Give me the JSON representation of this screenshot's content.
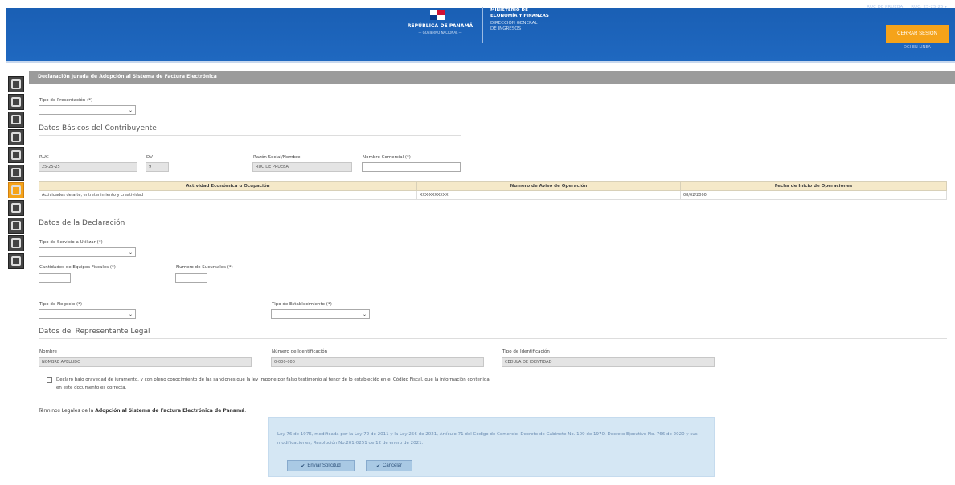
{
  "header": {
    "republic_name": "REPÚBLICA DE PANAMÁ",
    "republic_sub": "— GOBIERNO NACIONAL —",
    "ministry_line1": "MINISTERIO DE",
    "ministry_line2": "ECONOMÍA Y FINANZAS",
    "dgi_line1": "DIRECCIÓN GENERAL",
    "dgi_line2": "DE INGRESOS",
    "user_name": "RUC DE PRUEBA",
    "user_ruc": "RUC: 25-25-25 ▾",
    "logout_label": "CERRAR SESION",
    "dgi_online": "DGI EN LINEA"
  },
  "panel": {
    "title": "Declaración Jurada de Adopción al Sistema de Factura Electrónica"
  },
  "presentacion": {
    "label": "Tipo de Presentación (*)"
  },
  "basicos": {
    "title": "Datos Básicos del Contribuyente",
    "ruc_label": "RUC",
    "ruc_value": "25-25-25",
    "dv_label": "DV",
    "dv_value": "9",
    "razon_label": "Razón Social/Nombre",
    "razon_value": "RUC DE PRUEBA",
    "comercial_label": "Nombre Comercial (*)"
  },
  "activity_table": {
    "headers": [
      "Actividad Económica u Ocupación",
      "Numero de Aviso de Operación",
      "Fecha de Inicio de Operaciones"
    ],
    "row": [
      "Actividades de arte, entretenimiento y creatividad",
      "XXX-XXXXXXX",
      "08/02/2000"
    ]
  },
  "declaracion": {
    "title": "Datos de la Declaración",
    "servicio_label": "Tipo de Servicio a Utilizar (*)",
    "equipos_label": "Cantidades de Equipos Fiscales (*)",
    "sucursales_label": "Numero de Sucursales (*)",
    "negocio_label": "Tipo de Negocio (*)",
    "establecimiento_label": "Tipo de Establecimiento (*)"
  },
  "representante": {
    "title": "Datos del Representante Legal",
    "nombre_label": "Nombre",
    "nombre_value": "NOMBRE APELLIDO",
    "numero_label": "Número de Identificación",
    "numero_value": "0-000-000",
    "tipo_label": "Tipo de Identificación",
    "tipo_value": "CEDULA DE IDENTIDAD"
  },
  "declaro_text": "Declaro bajo gravedad de juramento, y con pleno conocimiento de las sanciones que la ley impone por falso testimonio al tenor de lo establecido en el Código Fiscal, que la información contenida en este documento es correcta.",
  "terminos": {
    "prefix": "Términos Legales de la ",
    "bold": "Adopción al Sistema de Factura Electrónica de Panamá",
    "suffix": "."
  },
  "legal": {
    "text": "Ley 76 de 1976, modificada por la Ley 72 de 2011 y la Ley 256 de 2021, Artículo 71 del Código de Comercio. Decreto de Gabinete No. 109 de 1970. Decreto Ejecutivo No. 766 de 2020 y sus modificaciones, Resolución No.201-0251 de 12 de enero de 2021.",
    "submit_label": "Enviar Solicitud",
    "cancel_label": "Cancelar"
  },
  "icons": [
    "check-icon",
    "chevron-down-icon",
    "panama-flag-icon"
  ],
  "colors": {
    "header_blue": "#1a5fb4",
    "accent_orange": "#f5a31a",
    "legal_box": "#d5e7f4",
    "table_header": "#f5e9c9"
  }
}
